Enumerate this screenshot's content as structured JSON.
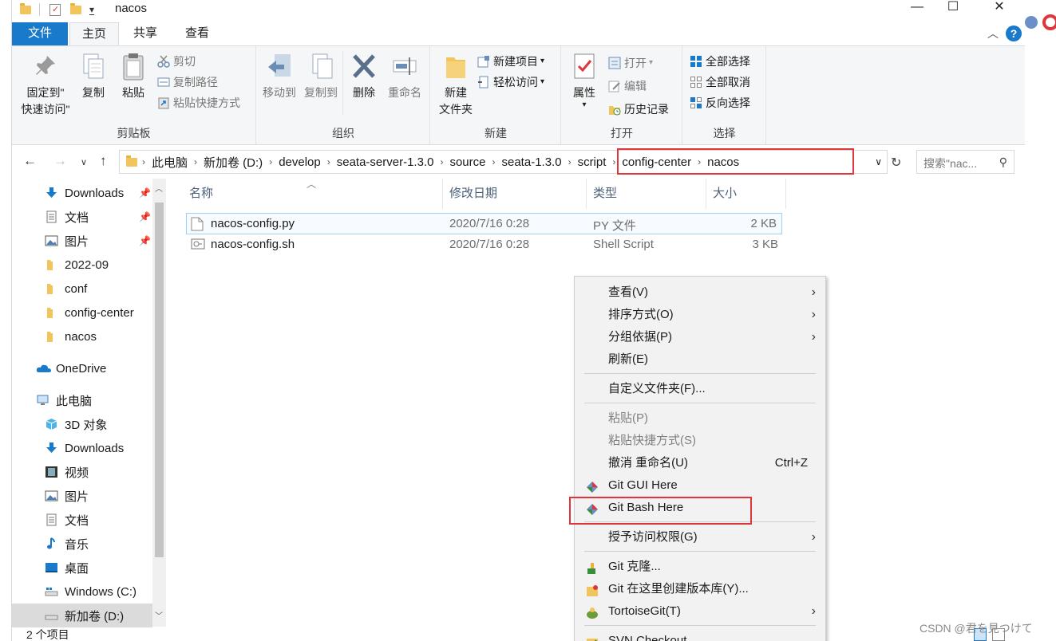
{
  "window": {
    "title": "nacos",
    "quick_access_dropdown": "▾",
    "minimize": "—",
    "maximize": "☐",
    "close": "✕"
  },
  "ribbon_tabs": [
    "文件",
    "主页",
    "共享",
    "查看"
  ],
  "ribbon": {
    "clipboard": {
      "label": "剪贴板",
      "pin_line1": "固定到\"",
      "pin_line2": "快速访问\"",
      "copy": "复制",
      "paste": "粘贴",
      "cut": "剪切",
      "copy_path": "复制路径",
      "paste_shortcut": "粘贴快捷方式"
    },
    "organize": {
      "label": "组织",
      "move_to": "移动到",
      "copy_to": "复制到",
      "delete": "删除",
      "rename": "重命名"
    },
    "new": {
      "label": "新建",
      "new_folder_line1": "新建",
      "new_folder_line2": "文件夹",
      "new_item": "新建项目",
      "easy_access": "轻松访问"
    },
    "open": {
      "label": "打开",
      "properties": "属性",
      "open": "打开",
      "edit": "编辑",
      "history": "历史记录"
    },
    "select": {
      "label": "选择",
      "select_all": "全部选择",
      "select_none": "全部取消",
      "invert": "反向选择"
    }
  },
  "address": {
    "crumbs": [
      "此电脑",
      "新加卷 (D:)",
      "develop",
      "seata-server-1.3.0",
      "source",
      "seata-1.3.0",
      "script",
      "config-center",
      "nacos"
    ],
    "search_placeholder": "搜索\"nac..."
  },
  "nav": {
    "quick_access": [
      {
        "label": "Downloads",
        "icon": "download-icon",
        "pinned": true
      },
      {
        "label": "文档",
        "icon": "document-icon",
        "pinned": true
      },
      {
        "label": "图片",
        "icon": "picture-icon",
        "pinned": true
      },
      {
        "label": "2022-09",
        "icon": "folder-icon",
        "pinned": false
      },
      {
        "label": "conf",
        "icon": "folder-icon",
        "pinned": false
      },
      {
        "label": "config-center",
        "icon": "folder-icon",
        "pinned": false
      },
      {
        "label": "nacos",
        "icon": "folder-icon",
        "pinned": false
      }
    ],
    "onedrive": "OneDrive",
    "this_pc": "此电脑",
    "pc_items": [
      {
        "label": "3D 对象",
        "icon": "cube-icon"
      },
      {
        "label": "Downloads",
        "icon": "download-icon"
      },
      {
        "label": "视频",
        "icon": "video-icon"
      },
      {
        "label": "图片",
        "icon": "picture-icon"
      },
      {
        "label": "文档",
        "icon": "document-icon"
      },
      {
        "label": "音乐",
        "icon": "music-icon"
      },
      {
        "label": "桌面",
        "icon": "desktop-icon"
      },
      {
        "label": "Windows (C:)",
        "icon": "drive-icon"
      },
      {
        "label": "新加卷 (D:)",
        "icon": "drive-icon"
      }
    ]
  },
  "files": {
    "columns": [
      "名称",
      "修改日期",
      "类型",
      "大小"
    ],
    "rows": [
      {
        "name": "nacos-config.py",
        "date": "2020/7/16 0:28",
        "type": "PY 文件",
        "size": "2 KB"
      },
      {
        "name": "nacos-config.sh",
        "date": "2020/7/16 0:28",
        "type": "Shell Script",
        "size": "3 KB"
      }
    ]
  },
  "status": {
    "item_count": "2 个项目"
  },
  "context_menu": {
    "items": [
      {
        "label": "查看(V)",
        "submenu": true
      },
      {
        "label": "排序方式(O)",
        "submenu": true
      },
      {
        "label": "分组依据(P)",
        "submenu": true
      },
      {
        "label": "刷新(E)"
      },
      {
        "label": "自定义文件夹(F)..."
      },
      {
        "label": "粘贴(P)",
        "disabled": true
      },
      {
        "label": "粘贴快捷方式(S)",
        "disabled": true
      },
      {
        "label": "撤消 重命名(U)",
        "shortcut": "Ctrl+Z"
      },
      {
        "label": "Git GUI Here",
        "icon": "git-icon"
      },
      {
        "label": "Git Bash Here",
        "icon": "git-icon"
      },
      {
        "label": "授予访问权限(G)",
        "submenu": true
      },
      {
        "label": "Git 克隆...",
        "icon": "git-clone-icon"
      },
      {
        "label": "Git 在这里创建版本库(Y)...",
        "icon": "git-repo-icon"
      },
      {
        "label": "TortoiseGit(T)",
        "submenu": true,
        "icon": "tortoisegit-icon"
      },
      {
        "label": "SVN Checkout...",
        "icon": "svn-icon"
      }
    ]
  },
  "watermark": "CSDN @君を見つけて",
  "colors": {
    "file_tab": "#1979ca",
    "highlight_red": "#e0353b",
    "selection_border": "#99d1ff"
  }
}
